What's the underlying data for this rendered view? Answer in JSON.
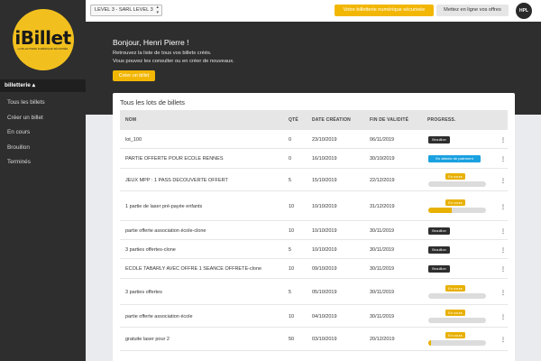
{
  "logo": {
    "text": "iBillet",
    "tagline": "LA BILLETTERIE NUMÉRIQUE SÉCURISÉE"
  },
  "sidebar": {
    "section": "billetterie",
    "items": [
      {
        "label": "Tous les billets"
      },
      {
        "label": "Créer un billet"
      },
      {
        "label": "En cours"
      },
      {
        "label": "Brouillon"
      },
      {
        "label": "Terminés"
      }
    ]
  },
  "topbar": {
    "select_value": "LEVEL 3 - SARL LEVEL 3",
    "btn_primary": "Votre billetterie numérique sécurisée",
    "btn_secondary": "Mettez en ligne vos offres",
    "avatar": "HPL"
  },
  "hero": {
    "title": "Bonjour, Henri Pierre !",
    "line1": "Retrouvez la liste de tous vos billets créés.",
    "line2": "Vous pouvez les consulter ou en créer de nouveaux.",
    "create_button": "Créer un billet"
  },
  "card": {
    "title": "Tous les lots de billets",
    "columns": [
      "NOM",
      "QTÉ",
      "DATE CRÉATION",
      "FIN DE VALIDITÉ",
      "PROGRESS."
    ],
    "rows": [
      {
        "name": "lot_100",
        "qty": "0",
        "created": "23/10/2019",
        "end": "06/11/2019",
        "status": "Brouillon",
        "kind": "dark"
      },
      {
        "name": "PARTIE OFFERTE POUR ECOLE RENNES",
        "qty": "0",
        "created": "16/10/2019",
        "end": "30/10/2019",
        "status": "En attente de paiement",
        "kind": "blue"
      },
      {
        "name": "JEUX MPP : 1 PASS DECOUVERTE OFFERT",
        "qty": "5",
        "created": "15/10/2019",
        "end": "22/12/2019",
        "status": "En cours",
        "kind": "progress",
        "progress": 0.0
      },
      {
        "name": "1 partie de laser pré-payée enfants",
        "qty": "10",
        "created": "10/10/2019",
        "end": "31/12/2019",
        "status": "En cours",
        "kind": "progress",
        "progress": 0.4
      },
      {
        "name": "partie offerte association école-clone",
        "qty": "10",
        "created": "10/10/2019",
        "end": "30/11/2019",
        "status": "Brouillon",
        "kind": "dark"
      },
      {
        "name": "3 parties offertes-clone",
        "qty": "5",
        "created": "10/10/2019",
        "end": "30/11/2019",
        "status": "Brouillon",
        "kind": "dark"
      },
      {
        "name": "ECOLE TABARLY AVEC OFFRE 1 SEANCE OFFRETE-clone",
        "qty": "10",
        "created": "09/10/2019",
        "end": "30/11/2019",
        "status": "Brouillon",
        "kind": "dark"
      },
      {
        "name": "3 parties offertes",
        "qty": "5",
        "created": "05/10/2019",
        "end": "30/11/2019",
        "status": "En cours",
        "kind": "progress",
        "progress": 0.0
      },
      {
        "name": "partie offerte association école",
        "qty": "10",
        "created": "04/10/2019",
        "end": "30/11/2019",
        "status": "En cours",
        "kind": "progress",
        "progress": 0.0
      },
      {
        "name": "gratuite laser pour 2",
        "qty": "50",
        "created": "03/10/2019",
        "end": "20/12/2019",
        "status": "En cours",
        "kind": "progress",
        "progress": 0.05
      }
    ]
  },
  "colors": {
    "accent": "#f2b705",
    "dark": "#2e2e2e",
    "blue": "#1aa1e0"
  }
}
